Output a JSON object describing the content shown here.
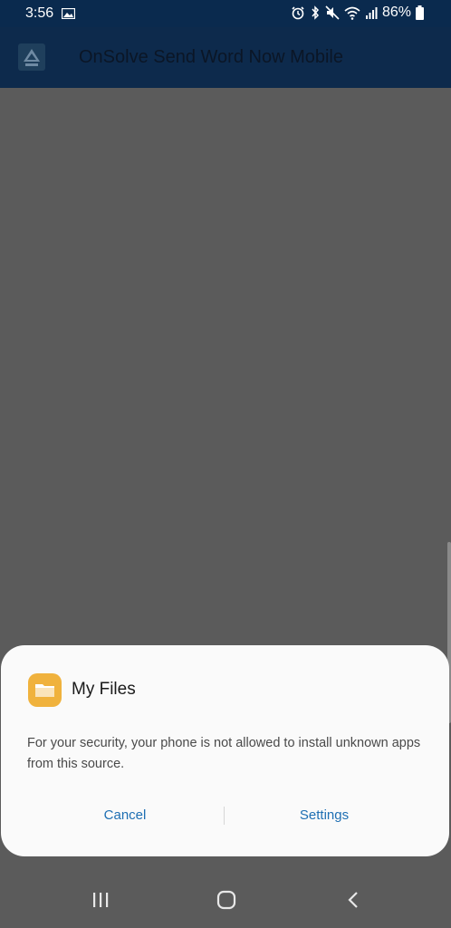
{
  "status_bar": {
    "time": "3:56",
    "battery": "86%",
    "icons": [
      "image-icon",
      "alarm-icon",
      "bluetooth-icon",
      "mute-icon",
      "wifi-icon",
      "signal-icon",
      "battery-icon"
    ]
  },
  "app_bar": {
    "title": "OnSolve Send Word Now Mobile",
    "logo_icon": "onsolve-logo-icon"
  },
  "dialog": {
    "app_name": "My Files",
    "app_icon": "folder-icon",
    "app_icon_color": "#f0b23d",
    "message": "For your security, your phone is not allowed to install unknown apps from this source.",
    "cancel_label": "Cancel",
    "settings_label": "Settings",
    "button_color": "#1e6fb3"
  },
  "nav_bar": {
    "buttons": [
      "recents-icon",
      "home-icon",
      "back-icon"
    ]
  },
  "colors": {
    "status_bar": "#0a2a4e",
    "app_bar": "#0d2a4c",
    "scrim": "#5b5b5b",
    "dialog_bg": "#fafafa"
  }
}
